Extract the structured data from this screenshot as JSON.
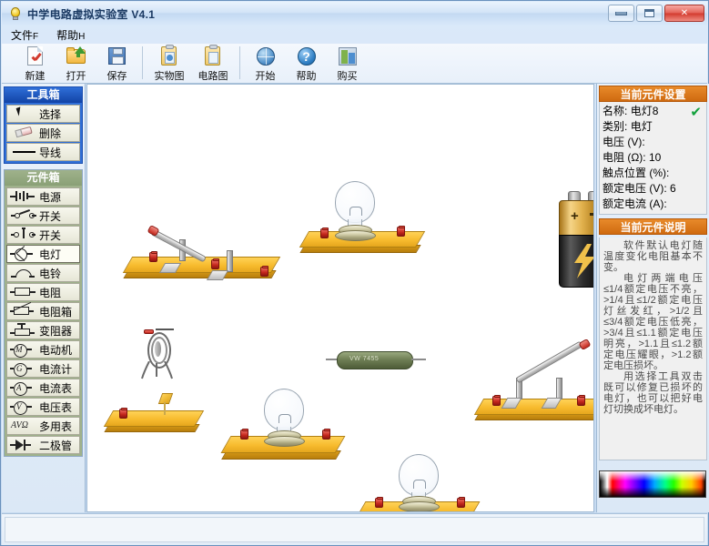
{
  "window": {
    "title": "中学电路虚拟实验室 V4.1",
    "icon": "lightbulb-icon",
    "buttons": {
      "minimize": "—",
      "maximize": "▫",
      "close": "✕"
    }
  },
  "menubar": {
    "items": [
      {
        "label": "文件",
        "accel": "F"
      },
      {
        "label": "帮助",
        "accel": "H"
      }
    ]
  },
  "toolbar": {
    "buttons": [
      {
        "label": "新建",
        "icon": "new-document-icon"
      },
      {
        "label": "打开",
        "icon": "open-folder-icon"
      },
      {
        "label": "保存",
        "icon": "save-disk-icon"
      },
      {
        "label": "实物图",
        "icon": "physical-view-icon"
      },
      {
        "label": "电路图",
        "icon": "schematic-view-icon"
      },
      {
        "label": "开始",
        "icon": "start-globe-icon"
      },
      {
        "label": "帮助",
        "icon": "help-question-icon"
      },
      {
        "label": "购买",
        "icon": "purchase-cart-icon"
      }
    ]
  },
  "toolbox": {
    "title": "工具箱",
    "items": [
      {
        "label": "选择",
        "icon": "cursor-arrow-icon"
      },
      {
        "label": "删除",
        "icon": "eraser-icon"
      },
      {
        "label": "导线",
        "icon": "wire-line-icon"
      }
    ]
  },
  "componentbox": {
    "title": "元件箱",
    "selected": "电灯",
    "items": [
      {
        "label": "电源",
        "icon": "battery-symbol-icon"
      },
      {
        "label": "开关",
        "icon": "switch-symbol-icon"
      },
      {
        "label": "开关",
        "icon": "pushbutton-symbol-icon"
      },
      {
        "label": "电灯",
        "icon": "lamp-symbol-icon"
      },
      {
        "label": "电铃",
        "icon": "bell-symbol-icon"
      },
      {
        "label": "电阻",
        "icon": "resistor-symbol-icon"
      },
      {
        "label": "电阻箱",
        "icon": "resistor-box-symbol-icon"
      },
      {
        "label": "变阻器",
        "icon": "rheostat-symbol-icon"
      },
      {
        "label": "电动机",
        "icon": "motor-symbol-icon"
      },
      {
        "label": "电流计",
        "icon": "galvanometer-symbol-icon"
      },
      {
        "label": "电流表",
        "icon": "ammeter-symbol-icon"
      },
      {
        "label": "电压表",
        "icon": "voltmeter-symbol-icon"
      },
      {
        "label": "多用表",
        "icon": "multimeter-symbol-icon",
        "prefix": "AVΩ"
      },
      {
        "label": "二极管",
        "icon": "diode-symbol-icon"
      }
    ]
  },
  "rightpanel": {
    "settings_title": "当前元件设置",
    "settings": [
      {
        "label": "名称:",
        "value": "电灯8"
      },
      {
        "label": "类别:",
        "value": "电灯"
      },
      {
        "label": "电压 (V):",
        "value": ""
      },
      {
        "label": "电阻 (Ω):",
        "value": "10"
      },
      {
        "label": "触点位置 (%):",
        "value": ""
      },
      {
        "label": "额定电压 (V):",
        "value": "6"
      },
      {
        "label": "额定电流 (A):",
        "value": ""
      }
    ],
    "confirm_mark": "✔",
    "desc_title": "当前元件说明",
    "desc_paragraphs": [
      "软件默认电灯随温度变化电阻基本不变。",
      "电灯两端电压≤1/4额定电压不亮，>1/4且≤1/2额定电压灯丝发红，>1/2且≤3/4额定电压低亮，>3/4且≤1.1额定电压明亮，>1.1且≤1.2额定电压耀眼，>1.2额定电压损坏。",
      "用选择工具双击既可以修复已损坏的电灯，也可以把好电灯切换成坏电灯。"
    ],
    "palette": "color-spectrum-picker"
  },
  "canvas": {
    "parts": [
      {
        "name": "knife-switch-closed",
        "label": "开关"
      },
      {
        "name": "lamp-on-base-1",
        "label": "电灯"
      },
      {
        "name": "battery-9v",
        "label": "电源"
      },
      {
        "name": "resistor-green",
        "label": "电阻",
        "text": "VW 7455"
      },
      {
        "name": "knife-switch-open",
        "label": "开关"
      },
      {
        "name": "electric-bell",
        "label": "电铃"
      },
      {
        "name": "lamp-on-base-2",
        "label": "电灯"
      },
      {
        "name": "lamp-on-base-3",
        "label": "电灯"
      },
      {
        "name": "empty-base",
        "label": "底座"
      }
    ]
  }
}
